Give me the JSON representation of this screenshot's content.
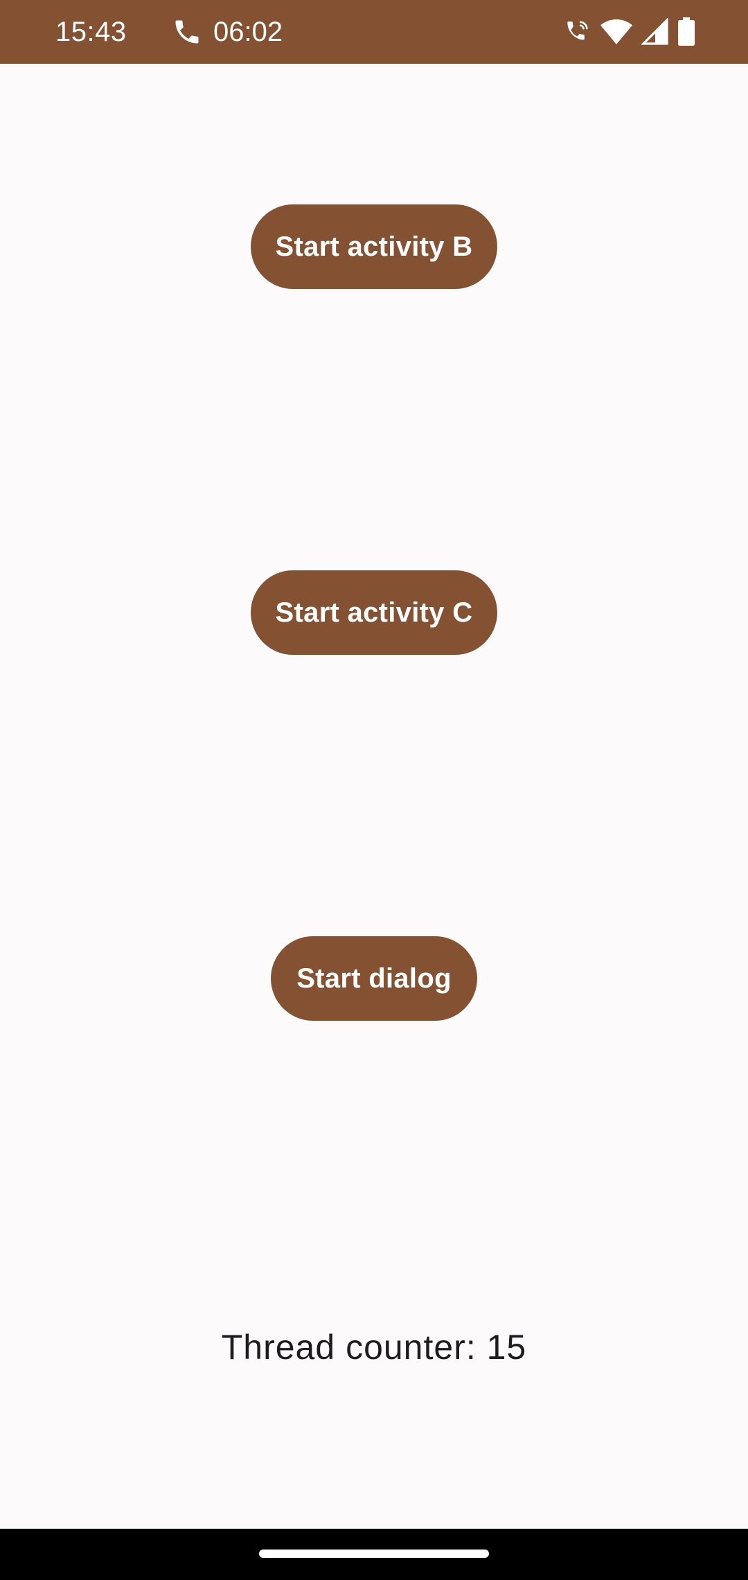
{
  "status_bar": {
    "time": "15:43",
    "call_duration": "06:02",
    "icons": [
      "phone-icon",
      "wifi-calling-icon",
      "wifi-icon",
      "signal-icon",
      "battery-icon"
    ],
    "background_color": "#845233"
  },
  "main": {
    "buttons": {
      "start_activity_b": "Start activity B",
      "start_activity_c": "Start activity C",
      "start_dialog": "Start dialog"
    },
    "thread_counter": "Thread counter: 15",
    "button_color": "#845233",
    "background_color": "#FDFAFC"
  },
  "nav_bar": {
    "background_color": "#000000"
  }
}
